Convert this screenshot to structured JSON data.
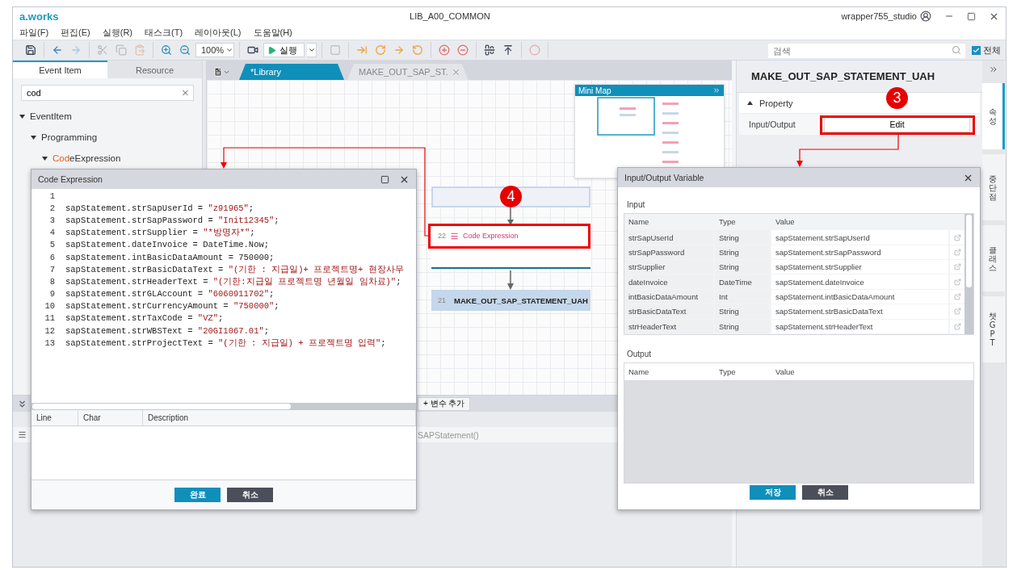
{
  "window": {
    "logo": "a.works",
    "title": "LIB_A00_COMMON",
    "user": "wrapper755_studio"
  },
  "menu": [
    "파일(F)",
    "편집(E)",
    "실행(R)",
    "태스크(T)",
    "레이아웃(L)",
    "도움말(H)"
  ],
  "toolbar": {
    "tools": [
      {
        "disabled": false
      },
      {
        "disabled": false
      },
      {
        "disabled": true
      },
      {
        "disabled": true
      },
      {
        "disabled": true
      },
      {
        "disabled": true
      },
      {
        "disabled": false
      },
      {
        "disabled": false
      },
      {
        "disabled": false
      },
      {
        "disabled": true
      },
      {
        "disabled": false
      },
      {
        "disabled": false
      },
      {
        "disabled": false
      },
      {
        "disabled": false
      },
      {
        "disabled": false
      },
      {
        "disabled": false
      },
      {
        "disabled": false
      },
      {
        "disabled": false
      },
      {
        "disabled": true
      }
    ],
    "zoom": "100%",
    "run": "실행",
    "search": {
      "placeholder": "검색"
    },
    "all": {
      "label": "전체",
      "checked": true
    }
  },
  "left_panel": {
    "tabs": [
      {
        "label": "Event Item",
        "selected": true
      },
      {
        "label": "Resource",
        "selected": false
      }
    ],
    "search": {
      "value": "cod"
    },
    "tree": [
      {
        "label": "EventItem",
        "expanded": true,
        "children": [
          {
            "label": "Programming",
            "expanded": true,
            "children": [
              {
                "label_match": "Cod",
                "label": "eExpression",
                "expanded": true
              }
            ]
          }
        ]
      }
    ]
  },
  "editor_tabs": [
    {
      "label": "*Library",
      "selected": true,
      "closable": false
    },
    {
      "label": "MAKE_OUT_SAP_ST.",
      "selected": false,
      "closable": true
    }
  ],
  "minimap": {
    "title": "Mini Map"
  },
  "flow_nodes": [
    {
      "kind": "blank"
    },
    {
      "kind": "code",
      "number": "22",
      "label": "Code Expression"
    },
    {
      "kind": "library",
      "number": "21",
      "label": "MAKE_OUT_SAP_STATEMENT_UAH"
    }
  ],
  "bottom_panel": {
    "add_button": "+ 변수 추가",
    "value": "SAPStatement()"
  },
  "properties": {
    "title": "MAKE_OUT_SAP_STATEMENT_UAH",
    "section": {
      "label": "Property",
      "expanded": true
    },
    "rows": [
      {
        "label": "Input/Output",
        "button": "Edit"
      }
    ]
  },
  "side_tabs": [
    {
      "label": "속성",
      "selected": true
    },
    {
      "label": "중단점",
      "selected": false
    },
    {
      "label": "클래스",
      "selected": false
    },
    {
      "label": "챗GPT",
      "selected": false
    }
  ],
  "code_dialog": {
    "title": "Code Expression",
    "lines": [
      {
        "number": "1"
      },
      {
        "number": "2",
        "code": "sapStatement.strSapUserId = ",
        "literal": "\"z91965\"",
        "tail": ";"
      },
      {
        "number": "3",
        "code": "sapStatement.strSapPassword = ",
        "literal": "\"Init12345\"",
        "tail": ";"
      },
      {
        "number": "4",
        "code": "sapStatement.strSupplier = ",
        "literal": "\"*방명자*\"",
        "tail": ";"
      },
      {
        "number": "5",
        "code": "sapStatement.dateInvoice = DateTime.Now;"
      },
      {
        "number": "6",
        "code": "sapStatement.intBasicDataAmount = 750000;"
      },
      {
        "number": "7",
        "code": "sapStatement.strBasicDataText = ",
        "literal": "\"(기한 : 지급일)+ 프로젝트명+ 현장사무"
      },
      {
        "number": "8",
        "code": "sapStatement.strHeaderText = ",
        "literal": "\"(기한:지급일 프로젝트명 년월일 임차료)\"",
        "tail": ";"
      },
      {
        "number": "9",
        "code": "sapStatement.strGLAccount = ",
        "literal": "\"6060911702\"",
        "tail": ";"
      },
      {
        "number": "10",
        "code": "sapStatement.strCurrencyAmount = ",
        "literal": "\"750000\"",
        "tail": ";"
      },
      {
        "number": "11",
        "code": "sapStatement.strTaxCode = ",
        "literal": "\"VZ\"",
        "tail": ";"
      },
      {
        "number": "12",
        "code": "sapStatement.strWBSText = ",
        "literal": "\"20GI1067.01\"",
        "tail": ";"
      },
      {
        "number": "13",
        "code": "sapStatement.strProjectText = ",
        "literal": "\"(기한 : 지급일) + 프로젝트명 입력\"",
        "tail": ";"
      }
    ],
    "error_columns": [
      "Line",
      "Char",
      "Description"
    ],
    "buttons": [
      {
        "label": "완료",
        "kind": "primary"
      },
      {
        "label": "취소",
        "kind": "secondary"
      }
    ]
  },
  "io_dialog": {
    "title": "Input/Output Variable",
    "input": {
      "label": "Input",
      "columns": [
        "Name",
        "Type",
        "Value"
      ],
      "rows": [
        {
          "name": "strSapUserId",
          "type": "String",
          "value": "sapStatement.strSapUserId"
        },
        {
          "name": "strSapPassword",
          "type": "String",
          "value": "sapStatement.strSapPassword"
        },
        {
          "name": "strSupplier",
          "type": "String",
          "value": "sapStatement.strSupplier"
        },
        {
          "name": "dateInvoice",
          "type": "DateTime",
          "value": "sapStatement.dateInvoice"
        },
        {
          "name": "intBasicDataAmount",
          "type": "Int",
          "value": "sapStatement.intBasicDataAmount"
        },
        {
          "name": "strBasicDataText",
          "type": "String",
          "value": "sapStatement.strBasicDataText"
        },
        {
          "name": "strHeaderText",
          "type": "String",
          "value": "sapStatement.strHeaderText"
        }
      ]
    },
    "output": {
      "label": "Output",
      "columns": [
        "Name",
        "Type",
        "Value"
      ]
    },
    "buttons": [
      {
        "label": "저장",
        "kind": "primary"
      },
      {
        "label": "취소",
        "kind": "secondary"
      }
    ]
  },
  "annotations": [
    {
      "label": "3"
    },
    {
      "label": "4"
    }
  ]
}
